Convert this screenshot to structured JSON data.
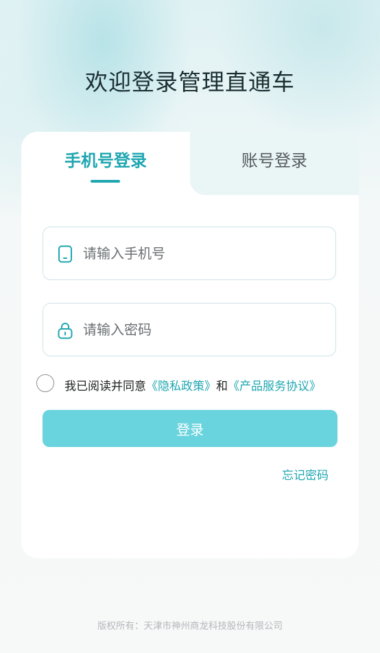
{
  "page": {
    "title": "欢迎登录管理直通车"
  },
  "tabs": [
    {
      "label": "手机号登录",
      "active": true
    },
    {
      "label": "账号登录",
      "active": false
    }
  ],
  "form": {
    "phone_placeholder": "请输入手机号",
    "phone_value": "",
    "password_placeholder": "请输入密码",
    "password_value": "",
    "phone_icon": "phone-icon",
    "lock_icon": "lock-icon"
  },
  "agreement": {
    "checked": false,
    "prefix": "我已阅读并同意",
    "privacy_link": "《隐私政策》",
    "connector": "和",
    "service_link": "《产品服务协议》"
  },
  "login_button": "登录",
  "forgot_password": "忘记密码",
  "footer": {
    "copyright": "版权所有：天津市神州商龙科技股份有限公司"
  },
  "colors": {
    "accent": "#1ea6b1",
    "button": "#69d4de",
    "title": "#1b2f33",
    "inactive_tab_bg": "#eaf5f6"
  }
}
